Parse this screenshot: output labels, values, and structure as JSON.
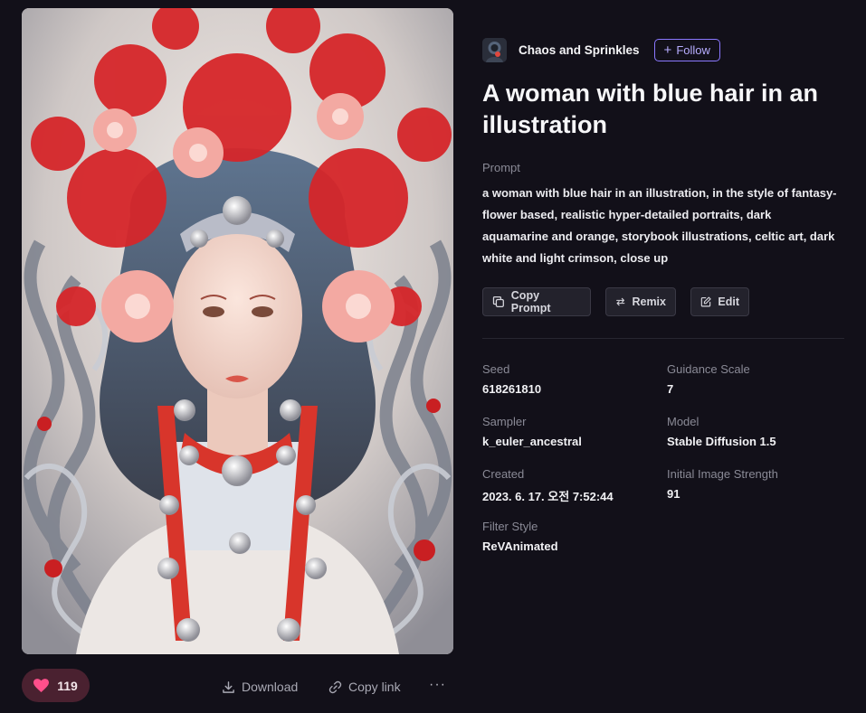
{
  "author": {
    "name": "Chaos and Sprinkles",
    "follow_label": "Follow",
    "follow_glyph": "+"
  },
  "title": "A woman with blue hair in an illustration",
  "prompt": {
    "label": "Prompt",
    "text": "a woman with blue hair in an illustration, in the style of fantasy-flower based, realistic hyper-detailed portraits, dark aquamarine and orange, storybook illustrations, celtic art, dark white and light crimson, close up"
  },
  "actions": {
    "copy_prompt": "Copy Prompt",
    "remix": "Remix",
    "edit": "Edit"
  },
  "metadata": {
    "seed": {
      "label": "Seed",
      "value": "618261810"
    },
    "guidance_scale": {
      "label": "Guidance Scale",
      "value": "7"
    },
    "sampler": {
      "label": "Sampler",
      "value": "k_euler_ancestral"
    },
    "model": {
      "label": "Model",
      "value": "Stable Diffusion 1.5"
    },
    "created": {
      "label": "Created",
      "value": "2023. 6. 17. 오전 7:52:44"
    },
    "initial_image_strength": {
      "label": "Initial Image Strength",
      "value": "91"
    },
    "filter_style": {
      "label": "Filter Style",
      "value": "ReVAnimated"
    }
  },
  "bottom_bar": {
    "likes": "119",
    "download": "Download",
    "copy_link": "Copy link",
    "more": "···"
  },
  "icons": {
    "heart": "heart-icon",
    "download": "download-icon",
    "link": "link-icon",
    "copy": "copy-icon",
    "remix": "remix-arrows-icon",
    "edit": "edit-pencil-icon"
  },
  "colors": {
    "background": "#121019",
    "accent": "#8a78ff",
    "like_bg": "#4a2130",
    "heart": "#ff4f8b"
  }
}
